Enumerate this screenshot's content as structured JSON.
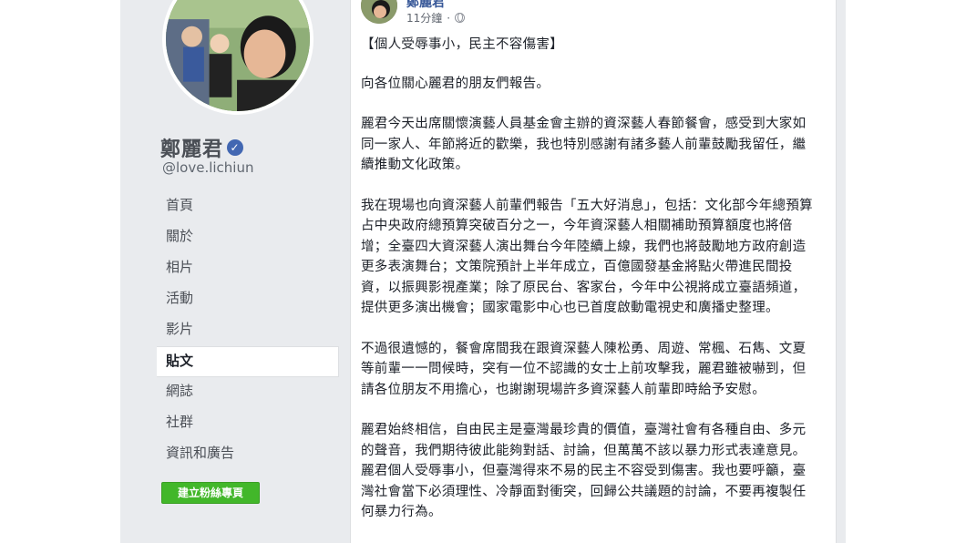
{
  "sidebar": {
    "page_name": "鄭麗君",
    "handle": "@love.lichiun",
    "nav": [
      {
        "label": "首頁"
      },
      {
        "label": "關於"
      },
      {
        "label": "相片"
      },
      {
        "label": "活動"
      },
      {
        "label": "影片"
      },
      {
        "label": "貼文",
        "active": true
      },
      {
        "label": "網誌"
      },
      {
        "label": "社群"
      },
      {
        "label": "資訊和廣告"
      }
    ],
    "create_button": "建立粉絲專頁"
  },
  "post": {
    "author": "鄭麗君",
    "time": "11分鐘",
    "title": "【個人受辱事小，民主不容傷害】",
    "paragraphs": [
      "向各位關心麗君的朋友們報告。",
      "麗君今天出席關懷演藝人員基金會主辦的資深藝人春節餐會，感受到大家如同一家人、年節將近的歡樂，我也特別感謝有諸多藝人前輩鼓勵我留任，繼續推動文化政策。",
      "我在現場也向資深藝人前輩們報告「五大好消息」，包括：文化部今年總預算占中央政府總預算突破百分之一，今年資深藝人相關補助預算額度也將倍增；全臺四大資深藝人演出舞台今年陸續上線，我們也將鼓勵地方政府創造更多表演舞台；文策院預計上半年成立，百億國發基金將點火帶進民間投資，以振興影視產業；除了原民台、客家台，今年中公視將成立臺語頻道，提供更多演出機會；國家電影中心也已首度啟動電視史和廣播史整理。",
      "不過很遺憾的，餐會席間我在跟資深藝人陳松勇、周遊、常楓、石雋、文夏等前輩一一問候時，突有一位不認識的女士上前攻擊我，麗君雖被嚇到，但請各位朋友不用擔心，也謝謝現場許多資深藝人前輩即時給予安慰。",
      "麗君始終相信，自由民主是臺灣最珍貴的價值，臺灣社會有各種自由、多元的聲音，我們期待彼此能夠對話、討論，但萬萬不該以暴力形式表達意見。麗君個人受辱事小，但臺灣得來不易的民主不容受到傷害。我也要呼籲，臺灣社會當下必須理性、冷靜面對衝突，回歸公共議題的討論，不要再複製任何暴力行為。"
    ]
  }
}
